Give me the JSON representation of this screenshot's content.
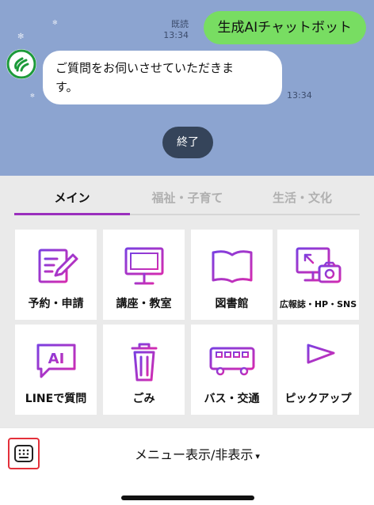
{
  "chat": {
    "user_message": "生成AIチャットボット",
    "read_status": "既読",
    "user_time": "13:34",
    "bot_message_line1": "ご質問をお伺いさせていただきま",
    "bot_message_line2": "す。",
    "bot_time": "13:34",
    "end_button": "終了"
  },
  "tabs": [
    {
      "label": "メイン",
      "active": true
    },
    {
      "label": "福祉・子育て",
      "active": false
    },
    {
      "label": "生活・文化",
      "active": false
    }
  ],
  "tiles": [
    {
      "label": "予約・申請",
      "icon": "pencil-form-icon"
    },
    {
      "label": "講座・教室",
      "icon": "monitor-icon"
    },
    {
      "label": "図書館",
      "icon": "open-book-icon"
    },
    {
      "label": "広報誌・HP・SNS",
      "icon": "monitor-camera-icon"
    },
    {
      "label": "LINEで質問",
      "icon": "ai-chat-bubble-icon"
    },
    {
      "label": "ごみ",
      "icon": "trash-can-icon"
    },
    {
      "label": "バス・交通",
      "icon": "bus-icon"
    },
    {
      "label": "ピックアップ",
      "icon": "flag-icon"
    }
  ],
  "footer": {
    "toggle_label": "メニュー表示/非表示",
    "toggle_caret": "▾"
  },
  "colors": {
    "chat_background": "#8ca4d0",
    "user_bubble": "#78dd62",
    "end_button": "#35445a",
    "tab_indicator": "#9a2fbd",
    "icon_gradient_start": "#7b3fe0",
    "icon_gradient_end": "#d42bb0",
    "keyboard_highlight": "#e4303a"
  }
}
